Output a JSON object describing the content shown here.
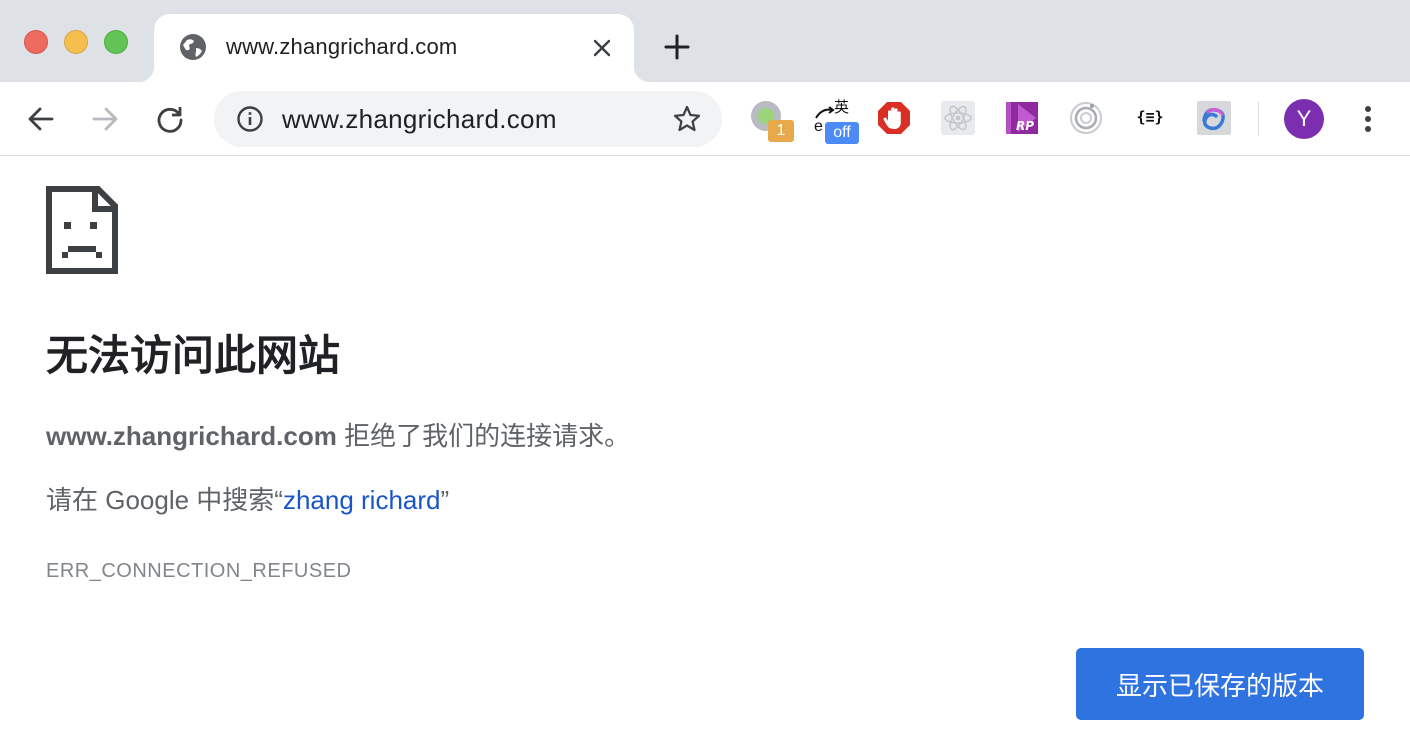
{
  "tab": {
    "title": "www.zhangrichard.com",
    "favicon": "globe-icon"
  },
  "omnibox": {
    "url": "www.zhangrichard.com"
  },
  "extensions": [
    {
      "name": "extension-green-dot",
      "badge": "1"
    },
    {
      "name": "extension-translate",
      "glyph_top": "英",
      "glyph_left": "e",
      "badge": "off"
    },
    {
      "name": "extension-adblock"
    },
    {
      "name": "extension-react-devtools"
    },
    {
      "name": "extension-axure-rp"
    },
    {
      "name": "extension-target"
    },
    {
      "name": "extension-json-viewer",
      "label": "{≡}"
    },
    {
      "name": "extension-colorful-loop"
    }
  ],
  "profile": {
    "initial": "Y",
    "color": "#7b2fb0"
  },
  "error": {
    "heading": "无法访问此网站",
    "host": "www.zhangrichard.com",
    "detail_rest": " 拒绝了我们的连接请求。",
    "suggest_prefix": "请在 Google 中搜索“",
    "suggest_link": "zhang richard",
    "suggest_suffix": "”",
    "code": "ERR_CONNECTION_REFUSED",
    "button_label": "显示已保存的版本"
  },
  "colors": {
    "tabstrip_bg": "#dee1e6",
    "link": "#1a55c7",
    "button_bg": "#2f73e0"
  }
}
